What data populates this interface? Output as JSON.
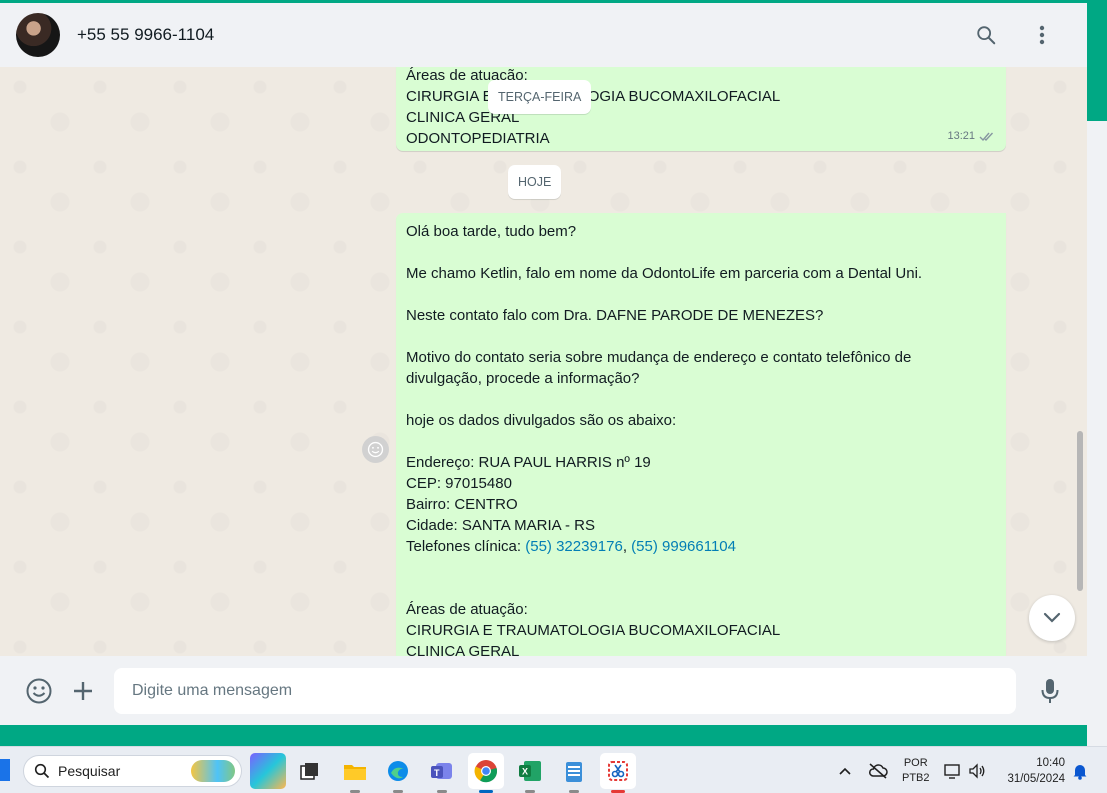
{
  "header": {
    "contact_name": "+55 55 9966-1104",
    "icons": [
      "search-icon",
      "menu-dots-icon"
    ]
  },
  "date_separators": {
    "previous": "TERÇA-FEIRA",
    "today": "HOJE"
  },
  "messages": {
    "previous": {
      "lines": [
        "Áreas de atuação:",
        "CIRURGIA E TRAUMATOLOGIA BUCOMAXILOFACIAL",
        "CLINICA GERAL",
        "ODONTOPEDIATRIA"
      ],
      "time": "13:21",
      "status": "read"
    },
    "current": {
      "lines": [
        "Olá boa tarde, tudo bem?",
        "",
        "Me chamo Ketlin, falo em nome da OdontoLife em parceria com a Dental Uni.",
        "",
        "Neste contato falo com Dra. DAFNE PARODE DE MENEZES?",
        "",
        "Motivo do contato seria sobre mudança de endereço e contato telefônico de",
        "divulgação, procede a informação?",
        "",
        "hoje os dados divulgados são os abaixo:",
        "",
        "Endereço: RUA PAUL HARRIS nº 19",
        "CEP: 97015480",
        "Bairro: CENTRO",
        "Cidade: SANTA MARIA - RS"
      ],
      "phones_label": "Telefones clínica: ",
      "phone_1": "(55) 32239176",
      "phone_sep": ", ",
      "phone_2": "(55) 999661104",
      "lines_after": [
        "",
        "",
        "Áreas de atuação:",
        "CIRURGIA E TRAUMATOLOGIA BUCOMAXILOFACIAL",
        "CLINICA GERAL"
      ]
    }
  },
  "composer": {
    "placeholder": "Digite uma mensagem",
    "icons": [
      "emoji-icon",
      "attach-plus-icon",
      "microphone-icon"
    ]
  },
  "taskbar": {
    "search_label": "Pesquisar",
    "lang_line1": "POR",
    "lang_line2": "PTB2",
    "time": "10:40",
    "date": "31/05/2024",
    "apps": [
      "copilot-pre",
      "task-view",
      "file-explorer",
      "edge",
      "teams",
      "chrome",
      "excel",
      "notepad",
      "snipping-tool"
    ]
  },
  "colors": {
    "accent": "#00a884",
    "bubble_out": "#d9fdd3",
    "link": "#027eb5",
    "read_ticks": "#53bdeb"
  }
}
